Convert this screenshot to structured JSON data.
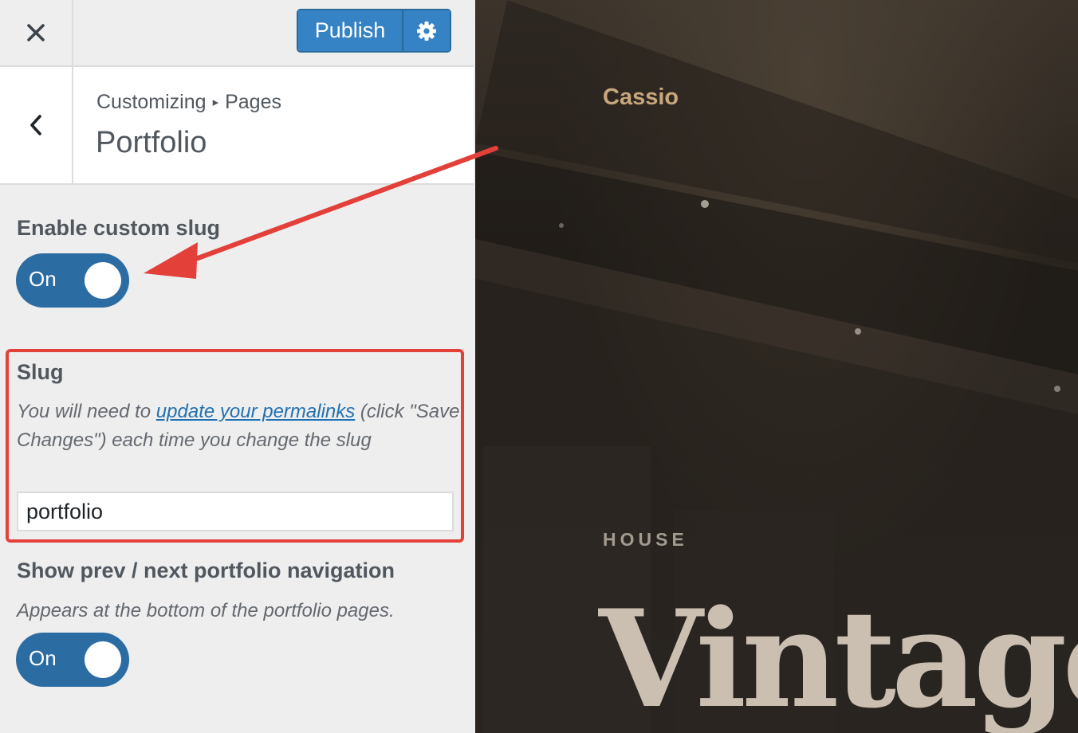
{
  "topbar": {
    "close_icon": "close-icon",
    "publish_label": "Publish",
    "settings_icon": "gear-icon"
  },
  "header": {
    "back_icon": "chevron-left-icon",
    "breadcrumb_parent": "Customizing",
    "breadcrumb_child": "Pages",
    "title": "Portfolio"
  },
  "controls": {
    "custom_slug": {
      "label": "Enable custom slug",
      "toggle_text": "On",
      "enabled": true
    },
    "slug": {
      "label": "Slug",
      "desc_before": "You will need to ",
      "desc_link": "update your permalinks",
      "desc_after": " (click \"Save Changes\") each time you change the slug",
      "value": "portfolio"
    },
    "portfolio_nav": {
      "label": "Show prev / next portfolio navigation",
      "desc": "Appears at the bottom of the portfolio pages.",
      "toggle_text": "On",
      "enabled": true
    }
  },
  "preview": {
    "site_name": "Cassio",
    "eyebrow": "HOUSE",
    "hero_word": "Vintage"
  },
  "colors": {
    "accent": "#3582c4",
    "toggle": "#2b6ca3",
    "annotation": "#e3403a",
    "site_name": "#c9a77c"
  }
}
